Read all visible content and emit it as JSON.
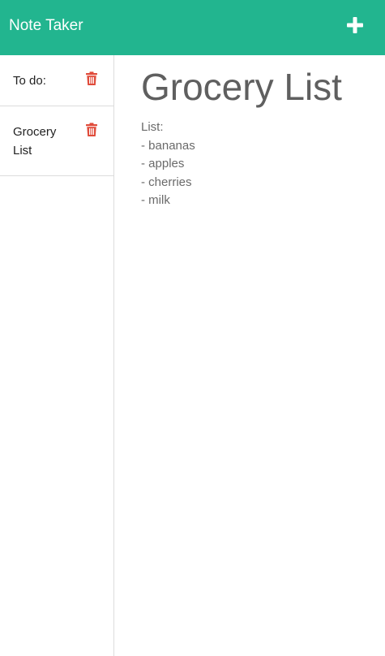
{
  "header": {
    "title": "Note Taker",
    "new_note_icon": "plus-icon",
    "bg_color": "#22b58f"
  },
  "sidebar": {
    "notes": [
      {
        "title": "To do:",
        "delete_icon": "trash-icon"
      },
      {
        "title": "Grocery List",
        "delete_icon": "trash-icon"
      }
    ],
    "delete_icon_color": "#e04b3a"
  },
  "main": {
    "note_title": "Grocery List",
    "note_text": [
      "List:",
      "- bananas",
      "- apples",
      "- cherries",
      "- milk"
    ]
  }
}
